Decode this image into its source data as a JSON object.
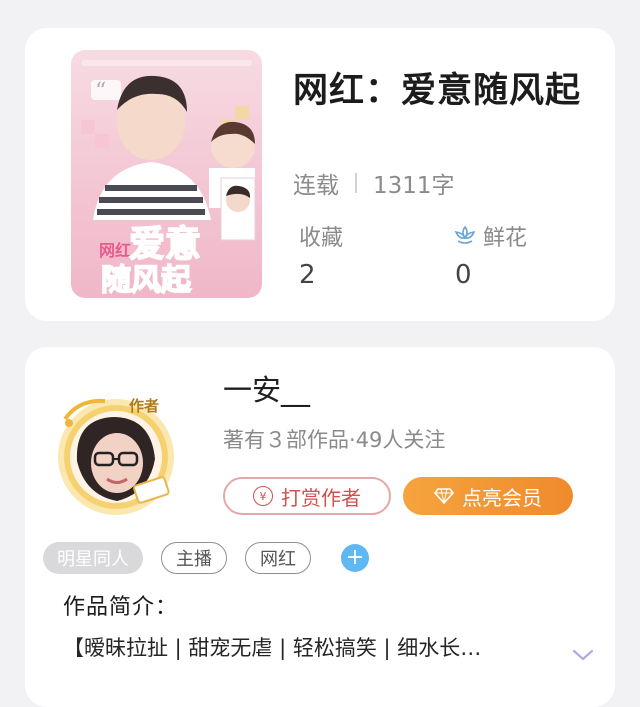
{
  "book": {
    "title": "网红：爱意随风起",
    "status": "连载",
    "word_count": "1311字",
    "collect_label": "收藏",
    "collect_count": "2",
    "flower_label": "鲜花",
    "flower_count": "0",
    "cover_title_small": "网红",
    "cover_title_main_1": "爱意",
    "cover_title_main_2": "随风起"
  },
  "author": {
    "name": "一安__",
    "stats": "著有３部作品·49人关注",
    "badge": "作者",
    "tip_button": "打赏作者",
    "vip_button": "点亮会员"
  },
  "tags": [
    "明星同人",
    "主播",
    "网红"
  ],
  "intro": {
    "title": "作品简介：",
    "text": "【暧昧拉扯 | 甜宠无虐 | 轻松搞笑 | 细水长…"
  },
  "colors": {
    "accent_orange": "#f08a2c",
    "tip_red": "#d0514f",
    "add_blue": "#5fb8f3"
  }
}
